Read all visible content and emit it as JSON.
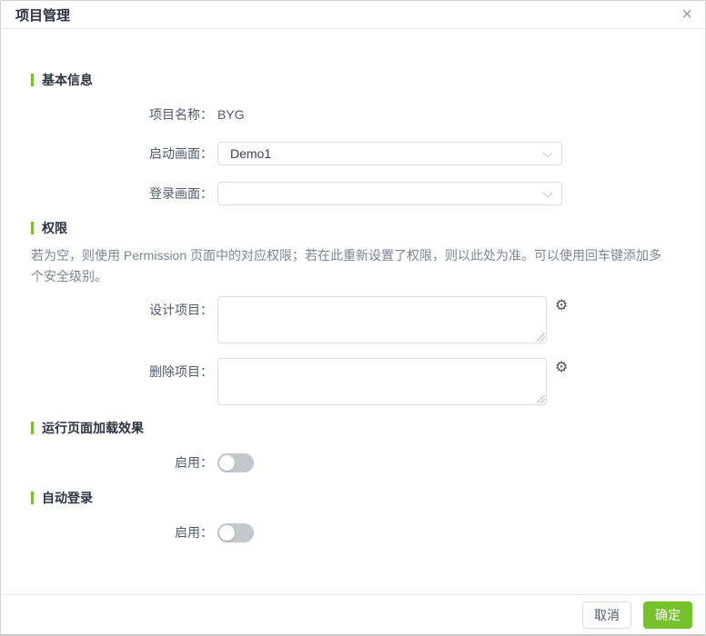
{
  "dialog": {
    "title": "项目管理"
  },
  "icons": {
    "close": "×",
    "gear": "⚙"
  },
  "colors": {
    "accent_green": "#76c22c",
    "section_bar": "#76c22c",
    "toggle_off": "#c3c7ce",
    "border": "#dcdee2",
    "description_text": "#7e8694"
  },
  "sections": {
    "basic": {
      "title": "基本信息",
      "fields": {
        "project_name": {
          "label": "项目名称：",
          "value": "BYG"
        },
        "startup_screen": {
          "label": "启动画面：",
          "value": "Demo1"
        },
        "login_screen": {
          "label": "登录画面：",
          "value": ""
        }
      }
    },
    "permission": {
      "title": "权限",
      "description": "若为空，则使用 Permission 页面中的对应权限；若在此重新设置了权限，则以此处为准。可以使用回车键添加多个安全级别。",
      "fields": {
        "design_project": {
          "label": "设计项目：",
          "value": ""
        },
        "delete_project": {
          "label": "删除项目：",
          "value": ""
        }
      }
    },
    "loading_effect": {
      "title": "运行页面加载效果",
      "enable_label": "启用：",
      "enabled": false
    },
    "auto_login": {
      "title": "自动登录",
      "enable_label": "启用：",
      "enabled": false
    }
  },
  "footer": {
    "cancel_label": "取消",
    "ok_label": "确定"
  }
}
